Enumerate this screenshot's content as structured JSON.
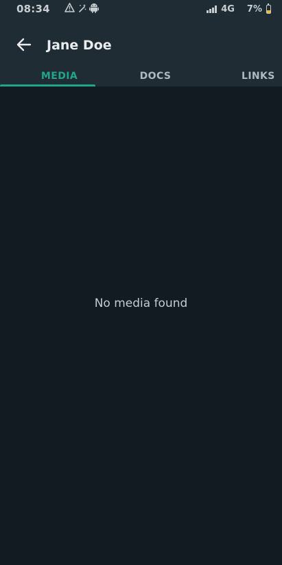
{
  "status_bar": {
    "time": "08:34",
    "left_icons": [
      "warning-icon",
      "magic-wand-icon",
      "android-icon"
    ],
    "network": "4G",
    "battery_percent": "7%",
    "battery_level": 0.07
  },
  "app_bar": {
    "back_icon": "arrow-left-icon",
    "title": "Jane Doe"
  },
  "tabs": [
    {
      "label": "MEDIA",
      "active": true
    },
    {
      "label": "DOCS",
      "active": false
    },
    {
      "label": "LINKS",
      "active": false
    }
  ],
  "content": {
    "empty_message": "No media found"
  },
  "colors": {
    "accent": "#21a58b",
    "background": "#121b22",
    "header": "#202c33",
    "status_bar": "#1f2c34"
  }
}
